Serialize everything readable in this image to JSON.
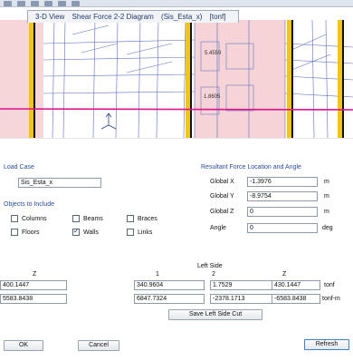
{
  "view": {
    "tab_label_1": "3-D View",
    "tab_label_2": "Shear Force 2-2 Diagram",
    "tab_label_3": "(Sis_Esta_x)",
    "tab_label_4": "[tonf]",
    "values": [
      "5.4559",
      "1.8605"
    ]
  },
  "load_case": {
    "heading": "Load Case",
    "value": "Sis_Esta_x"
  },
  "objects": {
    "heading": "Objects to Include",
    "items": [
      {
        "label": "Columns",
        "checked": false
      },
      {
        "label": "Beams",
        "checked": false
      },
      {
        "label": "Braces",
        "checked": false
      },
      {
        "label": "Floors",
        "checked": false
      },
      {
        "label": "Walls",
        "checked": true
      },
      {
        "label": "Links",
        "checked": false
      }
    ]
  },
  "resultant": {
    "heading": "Resultant Force Location and Angle",
    "x_label": "Global  X",
    "x_value": "-1.3976",
    "x_unit": "m",
    "y_label": "Global  Y",
    "y_value": "-8.9754",
    "y_unit": "m",
    "z_label": "Global  Z",
    "z_value": "0",
    "z_unit": "m",
    "angle_label": "Angle",
    "angle_value": "0",
    "angle_unit": "deg"
  },
  "table": {
    "side_label": "Left Side",
    "col_headers": [
      "Z",
      "1",
      "2",
      "Z"
    ],
    "row1": [
      "400.1447",
      "340.9604",
      "1.7529",
      "430.1447"
    ],
    "row1_unit": "tonf",
    "row2": [
      "5583.8438",
      "6847.7324",
      "-2378.1713",
      "-6583.8438"
    ],
    "row2_unit": "tonf-m"
  },
  "buttons": {
    "save_cut": "Save Left Side Cut",
    "ok": "OK",
    "cancel": "Cancel",
    "refresh": "Refresh"
  },
  "colors": {
    "pink_highlight": "#f3c8cc",
    "magenta_line": "#e0108f",
    "wall_yellow": "#f0c419",
    "grid_blue": "#5b6fbf",
    "accent_blue": "#2a4a9b"
  }
}
